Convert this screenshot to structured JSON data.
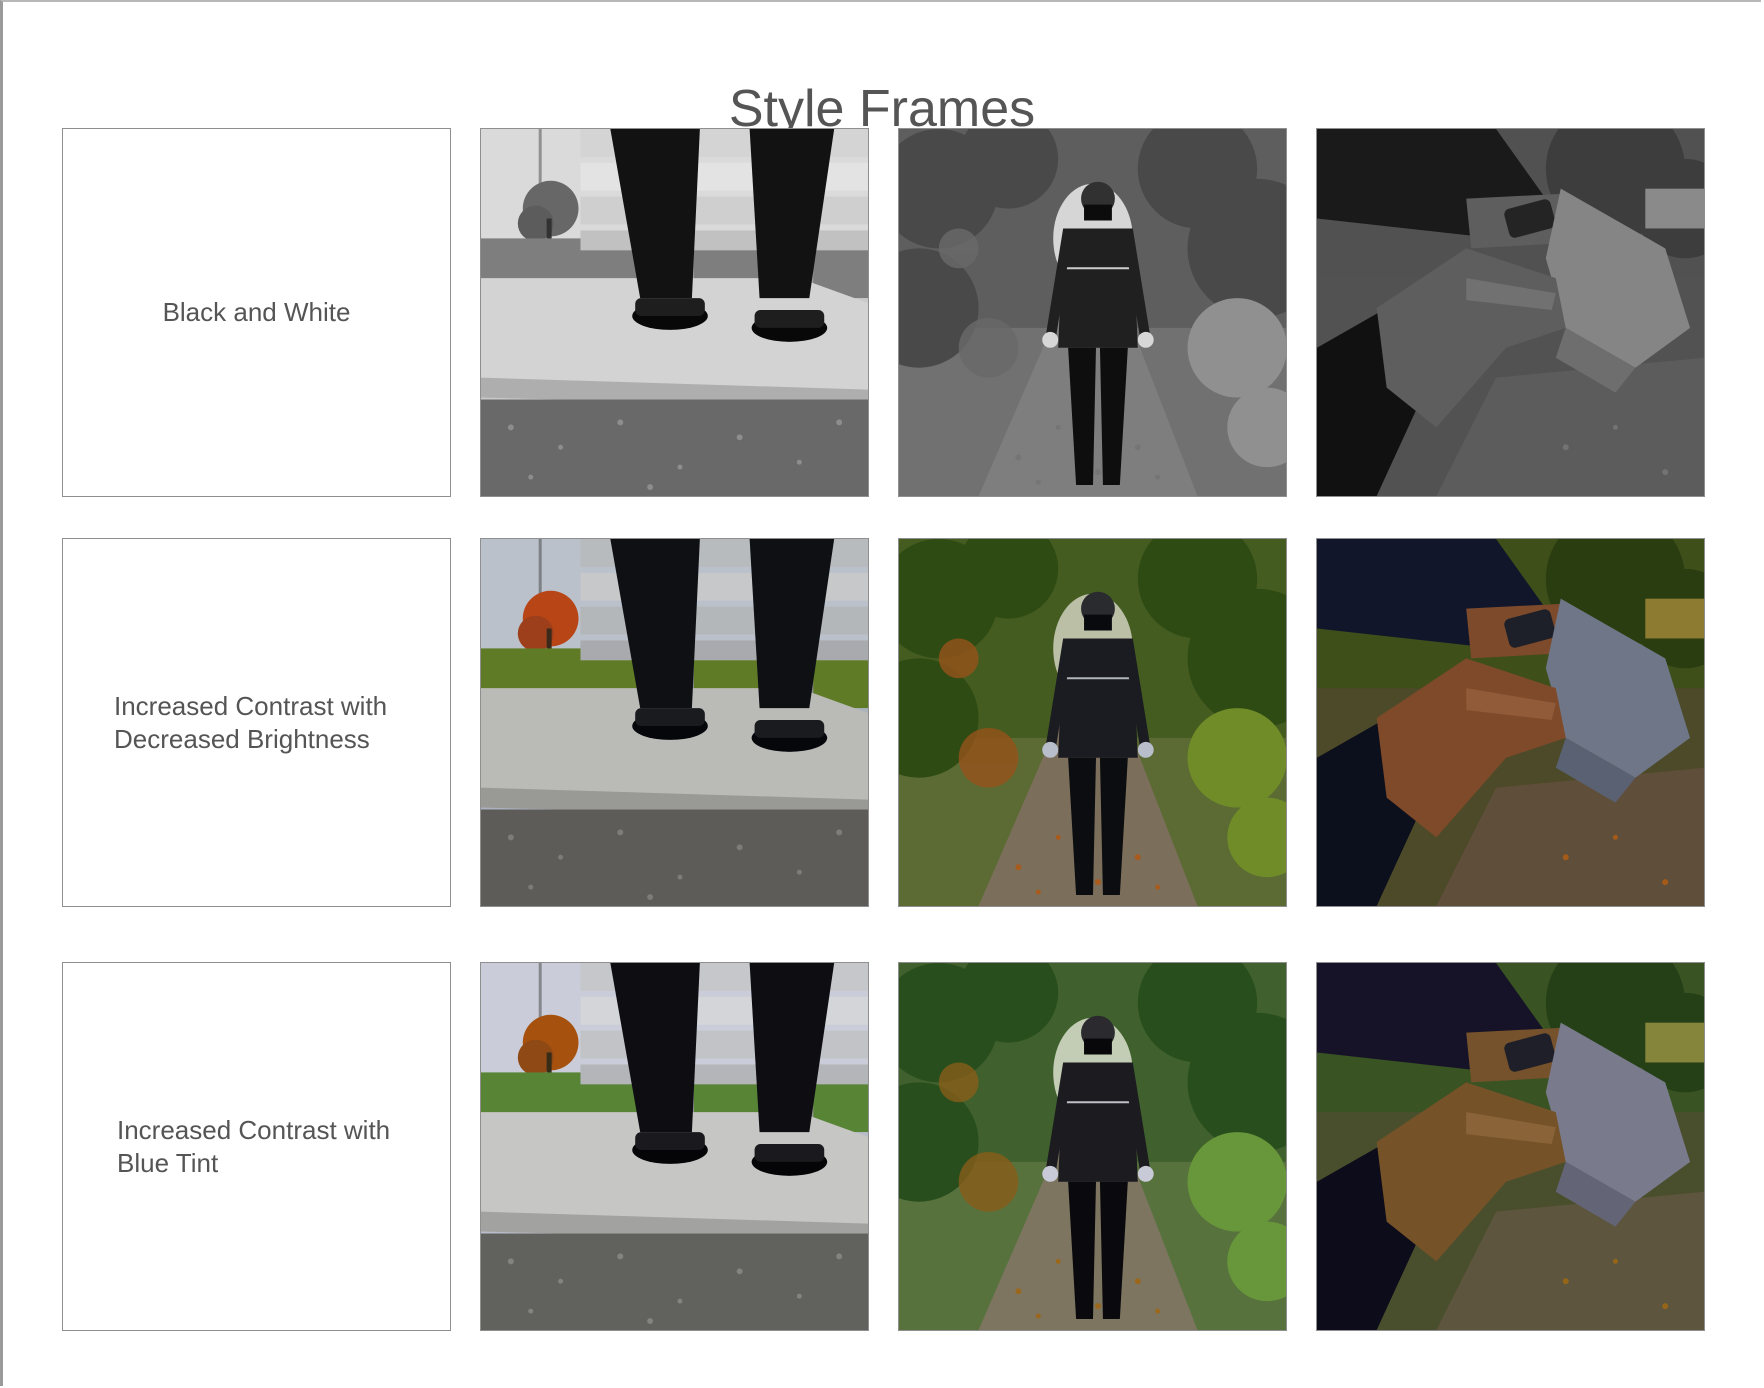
{
  "page": {
    "title": "Style Frames"
  },
  "rows": [
    {
      "label": "Black and White",
      "align": "center",
      "style": "black-and-white",
      "frames": [
        "bench-feet-photo",
        "trail-walker-photo",
        "wrist-watch-photo"
      ]
    },
    {
      "label": "Increased Contrast with\nDecreased Brightness",
      "align": "left",
      "style": "increased-contrast-decreased-brightness",
      "frames": [
        "bench-feet-photo",
        "trail-walker-photo",
        "wrist-watch-photo"
      ]
    },
    {
      "label": "Increased Contrast with\nBlue Tint",
      "align": "left",
      "style": "increased-contrast-blue-tint",
      "frames": [
        "bench-feet-photo",
        "trail-walker-photo",
        "wrist-watch-photo"
      ]
    }
  ],
  "colors": {
    "title_text": "#555555",
    "label_text": "#555555",
    "frame_border": "#8f8f8f"
  }
}
